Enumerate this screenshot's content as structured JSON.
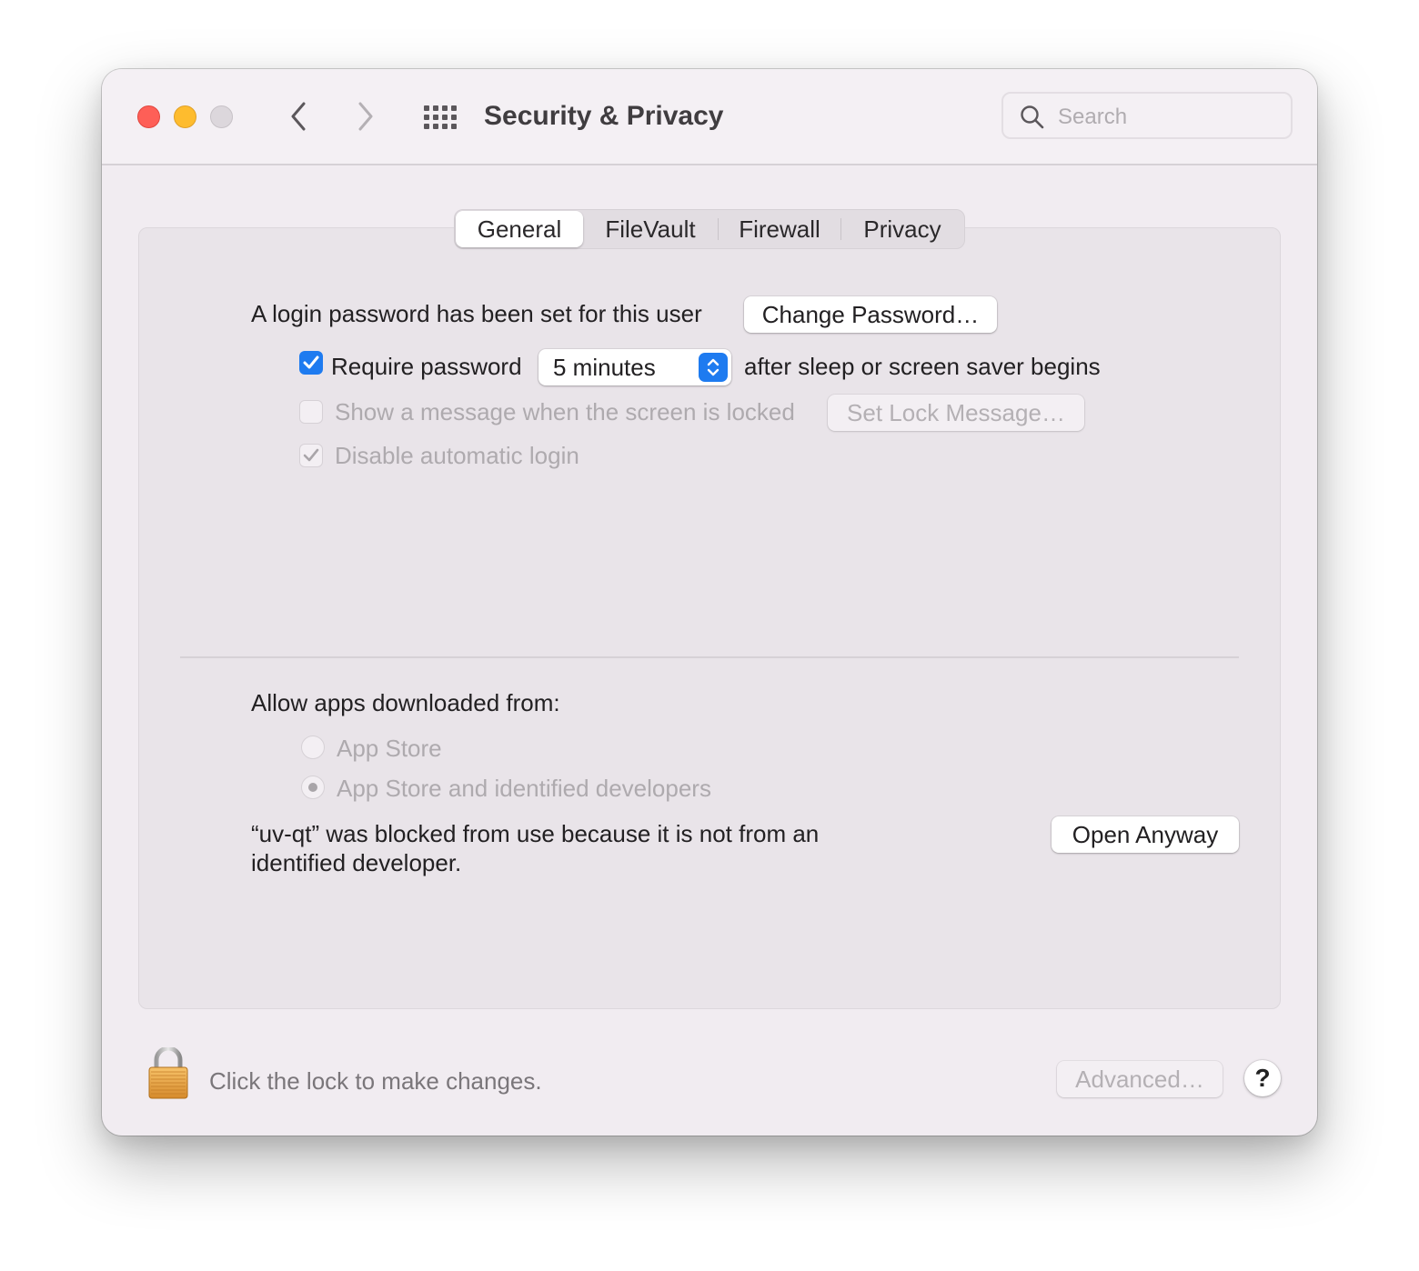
{
  "window": {
    "title": "Security & Privacy",
    "traffic_lights": [
      "close",
      "minimize",
      "zoom"
    ],
    "colors": {
      "close": "#fe5f57",
      "minimize": "#febc2e",
      "zoom_disabled": "#dcd7dc",
      "accent": "#1e7bf0"
    }
  },
  "toolbar": {
    "back_icon": "chevron-left-icon",
    "forward_icon": "chevron-right-icon",
    "grid_icon": "show-all-grid-icon",
    "search": {
      "placeholder": "Search",
      "value": ""
    }
  },
  "tabs": [
    {
      "label": "General",
      "active": true
    },
    {
      "label": "FileVault",
      "active": false
    },
    {
      "label": "Firewall",
      "active": false
    },
    {
      "label": "Privacy",
      "active": false
    }
  ],
  "general": {
    "password_status": "A login password has been set for this user",
    "change_password_button": "Change Password…",
    "require_password": {
      "label": "Require password",
      "checked": true,
      "enabled": true
    },
    "require_password_delay": {
      "selected": "5 minutes"
    },
    "require_password_suffix": "after sleep or screen saver begins",
    "show_message": {
      "label": "Show a message when the screen is locked",
      "checked": false,
      "enabled": false
    },
    "set_lock_message_button": "Set Lock Message…",
    "disable_auto_login": {
      "label": "Disable automatic login",
      "checked": true,
      "enabled": false
    },
    "allow_apps_label": "Allow apps downloaded from:",
    "allow_apps_options": [
      {
        "label": "App Store",
        "selected": false,
        "enabled": false
      },
      {
        "label": "App Store and identified developers",
        "selected": true,
        "enabled": false
      }
    ],
    "blocked_message_line1": "“uv-qt” was blocked from use because it is not from an",
    "blocked_message_line2": "identified developer.",
    "open_anyway_button": "Open Anyway"
  },
  "footer": {
    "lock_icon": "padlock-icon",
    "lock_text": "Click the lock to make changes.",
    "advanced_button": "Advanced…",
    "help_button": "?"
  }
}
